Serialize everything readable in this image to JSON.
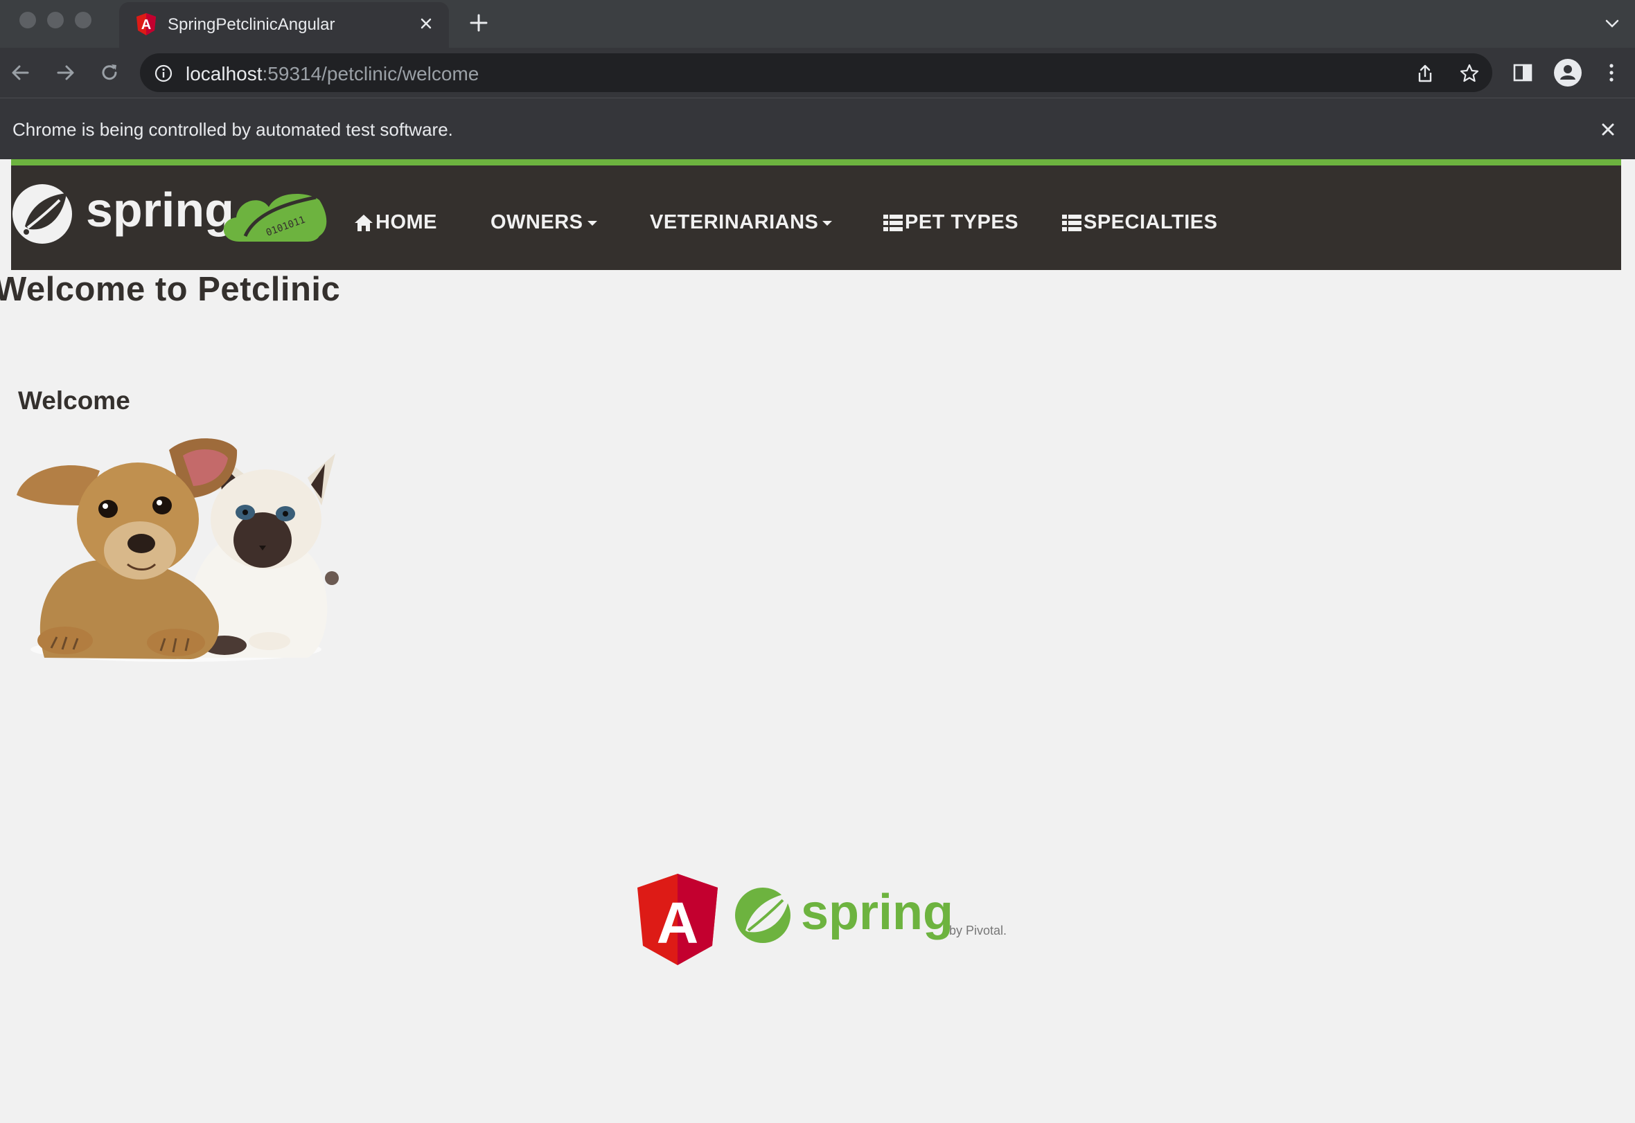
{
  "browser": {
    "tab_title": "SpringPetclinicAngular",
    "url_host": "localhost",
    "url_rest": ":59314/petclinic/welcome",
    "infobar_text": "Chrome is being controlled by automated test software."
  },
  "navbar": {
    "brand": "spring",
    "items": [
      {
        "label": "HOME"
      },
      {
        "label": "OWNERS"
      },
      {
        "label": "VETERINARIANS"
      },
      {
        "label": "PET TYPES"
      },
      {
        "label": "SPECIALTIES"
      }
    ]
  },
  "main": {
    "page_title": "Welcome to Petclinic",
    "section_title": "Welcome"
  },
  "footer": {
    "angular_logo_letter": "A",
    "spring_text": "spring",
    "by_text": "by Pivotal."
  },
  "colors": {
    "spring_green": "#6db33f",
    "navbar_bg": "#34302d",
    "angular_red": "#dd1b16"
  }
}
